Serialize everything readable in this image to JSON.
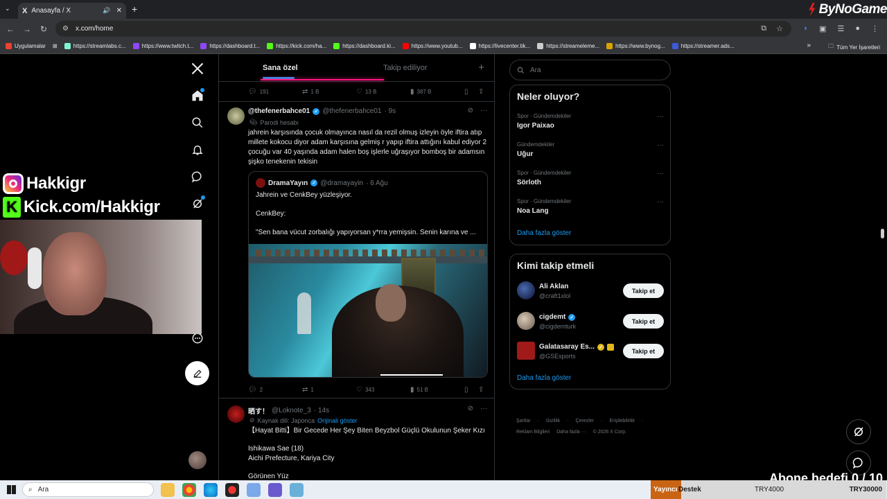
{
  "browser": {
    "tab_title": "Anasayfa / X",
    "tab_icon": "X",
    "url": "x.com/home",
    "brand": "ByNoGame",
    "bookmarks": [
      {
        "label": "Uygulamalar",
        "color": "#ea4335"
      },
      {
        "label": "https://streamlabs.c...",
        "color": "#80f5d2"
      },
      {
        "label": "https://www.twitch.t...",
        "color": "#9146ff"
      },
      {
        "label": "https://dashboard.t...",
        "color": "#9146ff"
      },
      {
        "label": "https://kick.com/ha...",
        "color": "#53fc18"
      },
      {
        "label": "https://dashboard.ki...",
        "color": "#53fc18"
      },
      {
        "label": "https://www.youtub...",
        "color": "#ff0000"
      },
      {
        "label": "https://livecenter.tik...",
        "color": "#ffffff"
      },
      {
        "label": "https://streameleme...",
        "color": "#cccccc"
      },
      {
        "label": "https://www.bynog...",
        "color": "#d9a400"
      },
      {
        "label": "https://streamer.ads...",
        "color": "#3b5bdb"
      }
    ],
    "all_bookmarks": "Tüm Yer İşaretleri"
  },
  "feed": {
    "tab_foryou": "Sana özel",
    "tab_following": "Takip ediliyor",
    "top_actions": {
      "replies": "191",
      "reposts": "1 B",
      "likes": "13 B",
      "views": "387 B"
    },
    "tweet1": {
      "name": "@thefenerbahce01",
      "handle": "@thefenerbahce01",
      "time": "· 9s",
      "label": "Parodi hesabı",
      "text": "jahrein karşısında çocuk olmayınca nasıl da rezil olmuş izleyin öyle iftira atıp millete kokocu diyor adam karşısına gelmiş r yapıp iftira attığını kabul ediyor 2 çocuğu var 40 yaşında adam halen boş işlerle uğraşıyor bomboş bir adamsın şişko tenekenin tekisin",
      "quote": {
        "name": "DramaYayın",
        "handle": "@dramayayin",
        "time": "· 6 Ağu",
        "line1": "Jahrein ve CenkBey yüzleşiyor.",
        "line2": "CenkBey:",
        "line3": "\"Sen bana vücut zorbalığı yapıyorsan y*rra yemişsin. Senin karına ve ..."
      },
      "actions": {
        "replies": "2",
        "reposts": "1",
        "likes": "343",
        "views": "51 B"
      }
    },
    "tweet2": {
      "name": "晒す！",
      "handle": "@Loknote_3",
      "time": "· 14s",
      "source": "Kaynak dili: Japonca",
      "original": "Orijinali göster",
      "line1": "【Hayat Bitti】Bir Gecede Her Şey Biten Beyzbol Güçlü Okulunun Şeker Kızı",
      "line2": "Ishikawa Sae (18)",
      "line3": "Aichi Prefecture, Kariya City",
      "line4": "Görünen Yüz"
    }
  },
  "sidebar": {
    "search_placeholder": "Ara",
    "trends_title": "Neler oluyor?",
    "trends": [
      {
        "category": "Spor · Gündemdekiler",
        "name": "Igor Paixao"
      },
      {
        "category": "Gündemdekiler",
        "name": "Uğur"
      },
      {
        "category": "Spor · Gündemdekiler",
        "name": "Sörloth"
      },
      {
        "category": "Spor · Gündemdekiler",
        "name": "Noa Lang"
      }
    ],
    "show_more": "Daha fazla göster",
    "who_title": "Kimi takip etmeli",
    "who": [
      {
        "name": "Ali Aklan",
        "handle": "@craft1xlol",
        "button": "Takip et"
      },
      {
        "name": "cigdemt",
        "handle": "@cigdemturk",
        "button": "Takip et"
      },
      {
        "name": "Galatasaray Es...",
        "handle": "@GSEsports",
        "button": "Takip et"
      }
    ],
    "footer": {
      "l1": [
        "Şartlar",
        "Gizlilik",
        "Çerezler",
        "Erişilebilirlik"
      ],
      "l2": [
        "Reklam Bilgileri",
        "Daha fazla ···",
        "© 2026 X Corp."
      ]
    }
  },
  "overlay": {
    "instagram": "Hakkigr",
    "kick": "Kick.com/Hakkigr",
    "kick_letter": "K",
    "abone": "Abone hedefi 0 / 10"
  },
  "taskbar": {
    "search": "Ara",
    "alert_left": "Yayıncı",
    "alert_mid": "Destek",
    "alert_val1": "TRY4000",
    "alert_val2": "TRY30000"
  }
}
